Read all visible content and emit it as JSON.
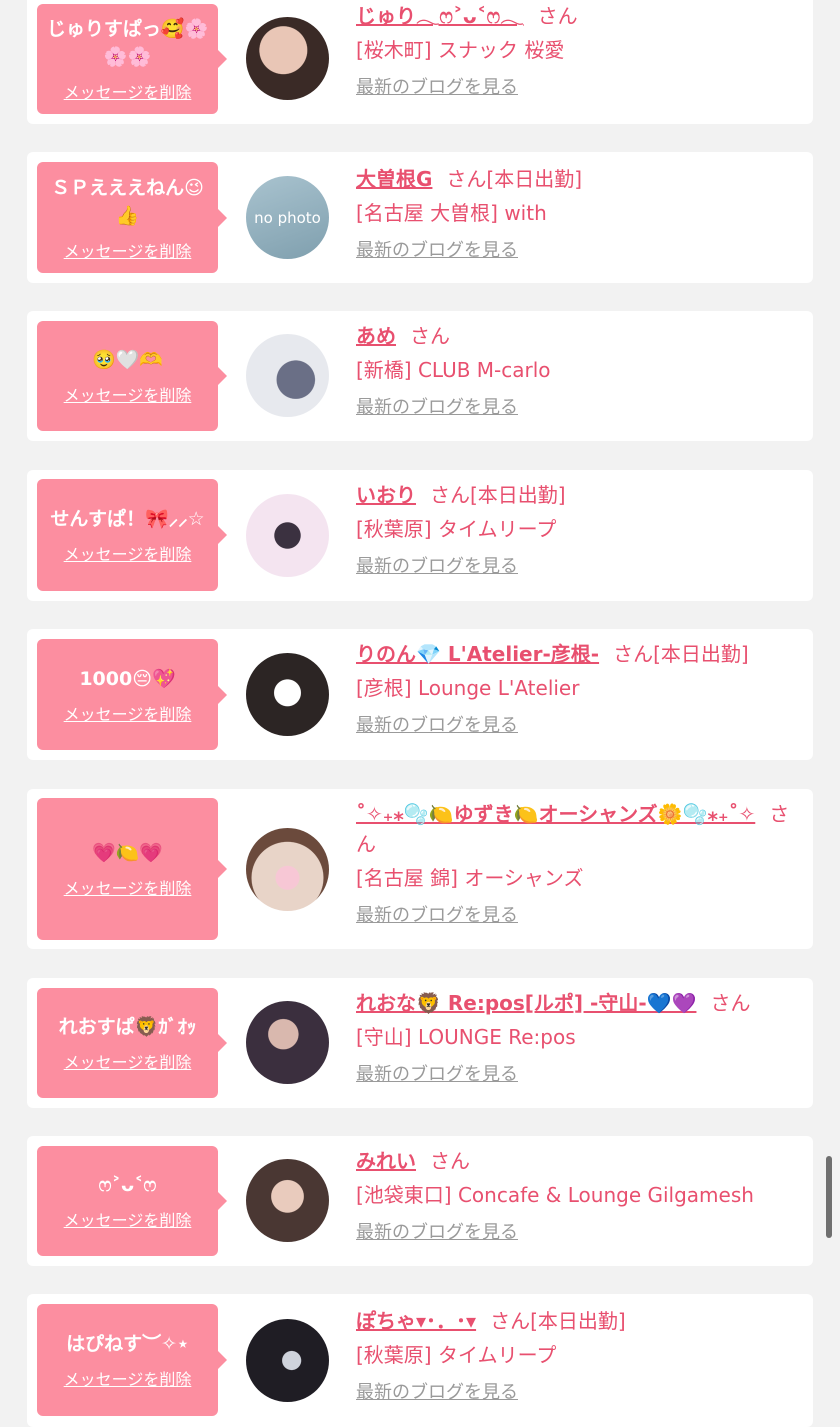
{
  "delete_label": "メッセージを削除",
  "blog_label": "最新のブログを見る",
  "san_label": "さん",
  "colors": {
    "accent": "#fc8ea0",
    "name_text": "#e8506f",
    "link_gray": "#9a9a9a",
    "background": "#f2f2f2"
  },
  "entries": [
    {
      "message": "じゅりすぱっ🥰🌸🌸🌸",
      "name": "じゅり𓂃ෆ˃ᴗ˂ෆ𓂃",
      "status": "",
      "shop": "[桜木町] スナック 桜愛"
    },
    {
      "message": "ＳＰえええねん😉👍",
      "name": "大曽根G",
      "status": "[本日出勤]",
      "shop": "[名古屋 大曽根] with",
      "avatar_text": "no photo"
    },
    {
      "message": "🥹🤍🫶",
      "name": "あめ",
      "status": "",
      "shop": "[新橋] CLUB M-carlo"
    },
    {
      "message": "せんすぱ！🎀⸝⸝☆",
      "name": "いおり",
      "status": "[本日出勤]",
      "shop": "[秋葉原] タイムリープ"
    },
    {
      "message": "1000😔💖",
      "name": "りのん💎 L'Atelier-彦根-",
      "status": "[本日出勤]",
      "shop": "[彦根] Lounge L'Atelier"
    },
    {
      "message": "💗🍋💗",
      "name": "˚✧₊⁎🫧🍋ゆずき🍋オーシャンズ🌼🫧⁎₊˚✧",
      "status": "",
      "shop": "[名古屋 錦] オーシャンズ"
    },
    {
      "message": "れおすぱ🦁ｶﾞｵｯ",
      "name": "れおな🦁 Re:pos[ルポ] -守山-💙💜",
      "status": "",
      "shop": "[守山] LOUNGE Re:pos"
    },
    {
      "message": "ෆ˃ᴗ˂ෆ",
      "name": "みれい",
      "status": "",
      "shop": "[池袋東口] Concafe & Lounge Gilgamesh"
    },
    {
      "message": "はぴねす︶✧⋆",
      "name": "ぽちゃ▾･．･▾",
      "status": "[本日出勤]",
      "shop": "[秋葉原] タイムリープ"
    }
  ]
}
